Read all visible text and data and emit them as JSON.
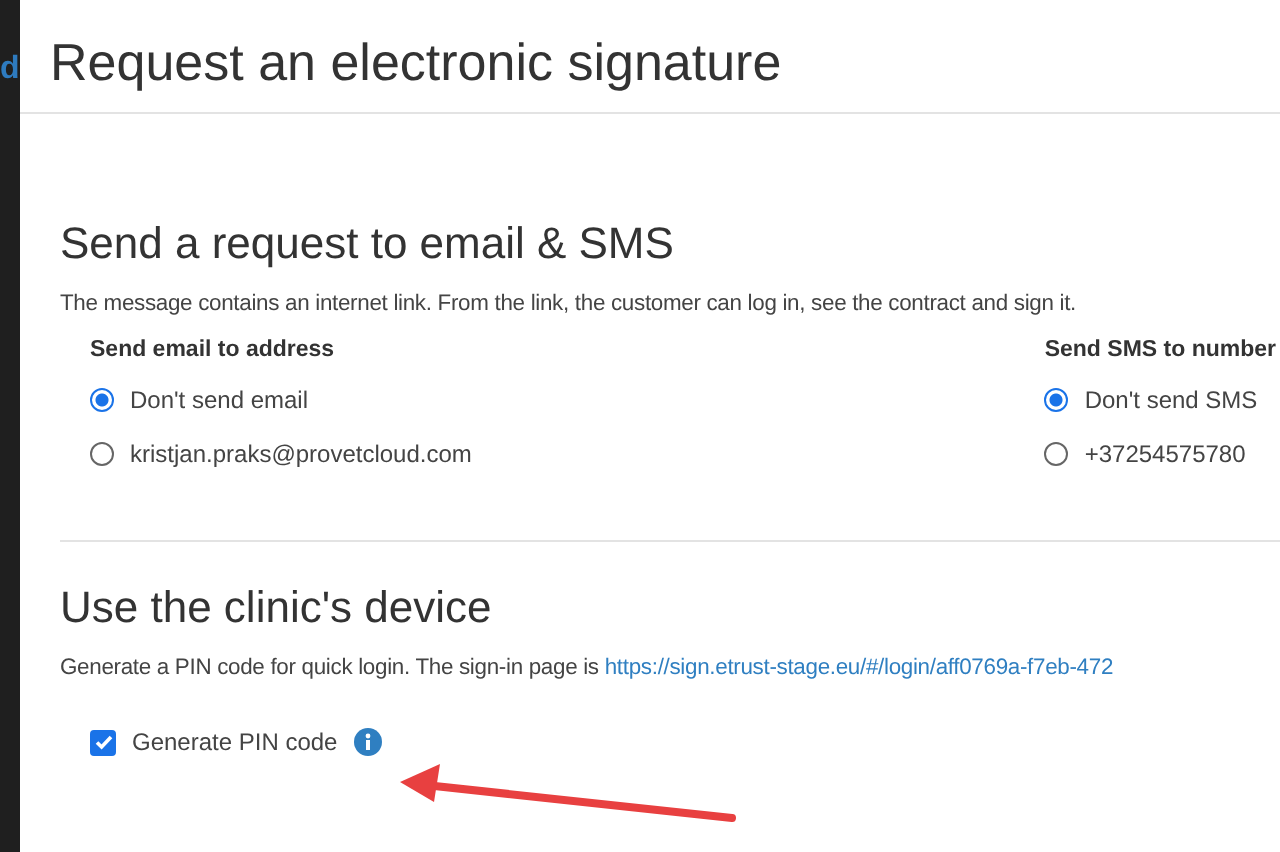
{
  "sidebar_fragment": "d",
  "dialog": {
    "title": "Request an electronic signature"
  },
  "request_section": {
    "heading": "Send a request to email & SMS",
    "description": "The message contains an internet link. From the link, the customer can log in, see the contract and sign it.",
    "groups": [
      {
        "label": "Send email to address",
        "options": [
          {
            "label": "Don't send email",
            "selected": true
          },
          {
            "label": "kristjan.praks@provetcloud.com",
            "selected": false
          }
        ]
      },
      {
        "label": "Send SMS to number",
        "options": [
          {
            "label": "Don't send SMS",
            "selected": true
          },
          {
            "label": "+37254575780",
            "selected": false
          }
        ]
      }
    ]
  },
  "device_section": {
    "heading": "Use the clinic's device",
    "description": "Generate a PIN code for quick login. The sign-in page is",
    "link": "https://sign.etrust-stage.eu/#/login/aff0769a-f7eb-472",
    "checkbox": {
      "label": "Generate PIN code",
      "checked": true
    }
  }
}
